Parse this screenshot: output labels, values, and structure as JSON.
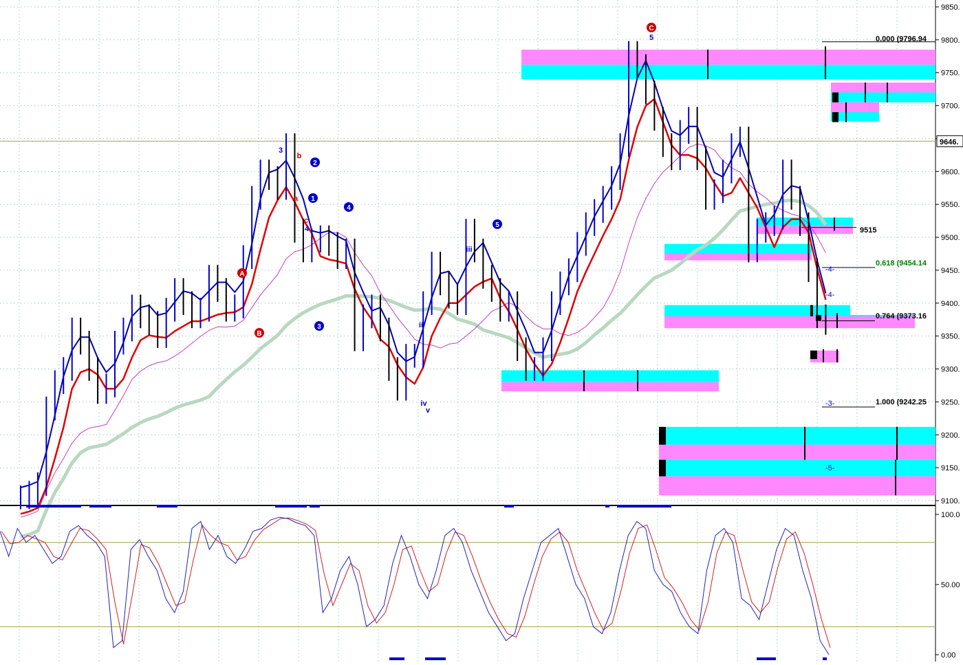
{
  "colors": {
    "background": "#ffffff",
    "grid": "#7fb8b8",
    "price_bars": "#0000cc",
    "price_bars_down": "#000000",
    "ma_fast": "#0000b4",
    "ma_slow": "#e00000",
    "ma_long": "#c040c0",
    "ma_trend": "#b8d8c0",
    "zone_cyan": "#00ffff",
    "zone_magenta": "#ff88ff",
    "stoch_k": "#2020c0",
    "stoch_d": "#d02020",
    "stoch_levels": "#a0a040",
    "label_blue": "#0000cc",
    "label_red": "#cc0000",
    "fib_green": "#008000"
  },
  "price_panel": {
    "axis_ticks": [
      "9850.",
      "9800.",
      "9750.",
      "9700.",
      "9650.",
      "9600.",
      "9550.",
      "9500.",
      "9450.",
      "9400.",
      "9350.",
      "9300.",
      "9250.",
      "9200.",
      "9150.",
      "9100."
    ],
    "current_price_label": "9646.",
    "current_price": 9646,
    "fib_labels": [
      {
        "text": "0.000 (9796.94",
        "value": 9796.94,
        "color": "#000000"
      },
      {
        "text": "0.618 (9454.14",
        "value": 9454.14,
        "color": "#008000"
      },
      {
        "text": "0.764 (9373.16",
        "value": 9373.16,
        "color": "#000000"
      },
      {
        "text": "1.000 (9242.25",
        "value": 9242.25,
        "color": "#000000"
      }
    ],
    "level_text": "9515",
    "projection_labels": [
      "-3-",
      "-4-",
      "-5-"
    ]
  },
  "wave_labels": [
    {
      "text": "C",
      "style": "circle-red"
    },
    {
      "text": "5",
      "style": "blue"
    },
    {
      "text": "3",
      "style": "blue"
    },
    {
      "text": "b",
      "style": "red"
    },
    {
      "text": "2",
      "style": "circle-blue"
    },
    {
      "text": "1",
      "style": "circle-blue"
    },
    {
      "text": "a",
      "style": "red"
    },
    {
      "text": "c",
      "style": "red"
    },
    {
      "text": "4",
      "style": "blue"
    },
    {
      "text": "A",
      "style": "circle-red"
    },
    {
      "text": "B",
      "style": "circle-red"
    },
    {
      "text": "3",
      "style": "circle-blue"
    },
    {
      "text": "4",
      "style": "circle-blue"
    },
    {
      "text": "5",
      "style": "circle-blue"
    },
    {
      "text": "iii",
      "style": "blue"
    },
    {
      "text": "iv",
      "style": "blue"
    },
    {
      "text": "v",
      "style": "blue"
    },
    {
      "text": "ii",
      "style": "blue"
    }
  ],
  "stoch_panel": {
    "axis_ticks": [
      "100.0",
      "50.00",
      "0.00"
    ],
    "upper_level": 80,
    "lower_level": 20
  },
  "chart_data": {
    "type": "line",
    "title": "",
    "ylim": [
      9100,
      9850
    ],
    "series": [
      {
        "values": [
          9105,
          9112,
          9125,
          9240,
          9280,
          9300,
          9360,
          9340,
          9300,
          9265,
          9275,
          9340,
          9360,
          9395,
          9380,
          9370,
          9350,
          9390,
          9420,
          9400,
          9380,
          9390,
          9440,
          9420,
          9390,
          9395,
          9470,
          9560,
          9600,
          9590,
          9575,
          9640,
          9510,
          9480,
          9495,
          9500,
          9490,
          9470,
          9480,
          9345,
          9380,
          9395,
          9360,
          9300,
          9270,
          9320,
          9320,
          9400,
          9460,
          9430,
          9410,
          9400,
          9510,
          9480,
          9440,
          9420,
          9390,
          9400,
          9330,
          9300,
          9300,
          9330,
          9400,
          9430,
          9450,
          9490,
          9520,
          9540,
          9560,
          9590,
          9640,
          9780,
          9760,
          9720,
          9680,
          9640,
          9620,
          9660,
          9680,
          9620,
          9560,
          9570,
          9600,
          9640,
          9650,
          9480,
          9510,
          9520,
          9530,
          9600,
          9560,
          9520,
          9450,
          9380,
          9370
        ]
      }
    ],
    "stoch_series": [
      {
        "values": [
          88,
          70,
          90,
          80,
          85,
          75,
          65,
          70,
          88,
          92,
          85,
          80,
          70,
          5,
          10,
          75,
          82,
          70,
          60,
          40,
          30,
          45,
          90,
          95,
          75,
          85,
          70,
          65,
          75,
          88,
          90,
          96,
          98,
          97,
          94,
          92,
          85,
          30,
          40,
          60,
          70,
          50,
          20,
          25,
          35,
          65,
          85,
          70,
          50,
          40,
          60,
          85,
          90,
          80,
          60,
          45,
          30,
          20,
          10,
          15,
          40,
          60,
          80,
          85,
          90,
          70,
          50,
          40,
          20,
          15,
          30,
          60,
          85,
          95,
          90,
          60,
          50,
          45,
          30,
          20,
          15,
          60,
          85,
          90,
          80,
          40,
          35,
          25,
          50,
          75,
          90,
          85,
          60,
          40,
          10,
          0
        ]
      }
    ]
  }
}
